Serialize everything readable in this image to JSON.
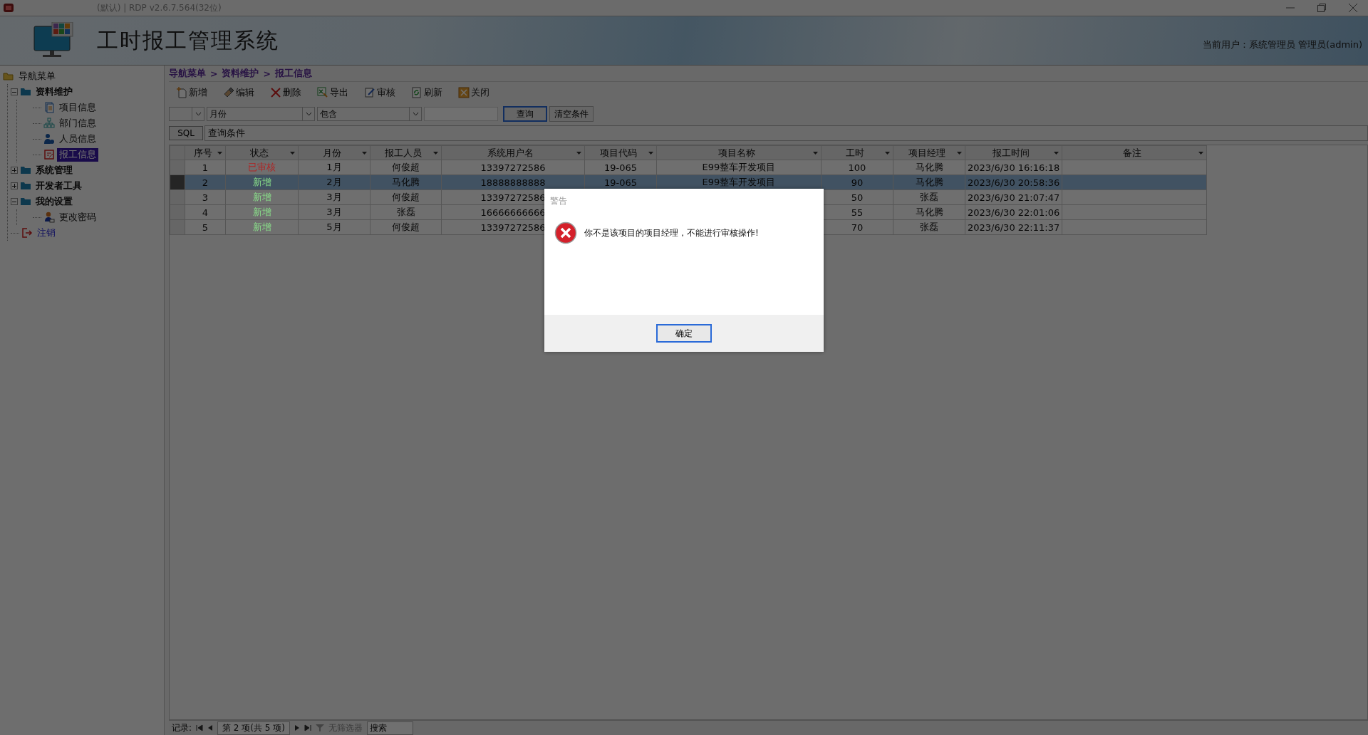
{
  "window": {
    "title": "(默认) | RDP v2.6.7.564(32位)"
  },
  "header": {
    "title": "工时报工管理系统",
    "user": "当前用户：系统管理员 管理员(admin)"
  },
  "sidebar": {
    "items": [
      {
        "label": "导航菜单",
        "kind": "root",
        "selected": false,
        "expanded": true,
        "children": [
          {
            "label": "资料维护",
            "kind": "folder",
            "selected": false,
            "expanded": true,
            "children": [
              {
                "label": "项目信息",
                "kind": "document",
                "selected": false
              },
              {
                "label": "部门信息",
                "kind": "org",
                "selected": false
              },
              {
                "label": "人员信息",
                "kind": "person",
                "selected": false
              },
              {
                "label": "报工信息",
                "kind": "report",
                "selected": true
              }
            ]
          },
          {
            "label": "系统管理",
            "kind": "folder",
            "selected": false,
            "expanded": false
          },
          {
            "label": "开发者工具",
            "kind": "folder",
            "selected": false,
            "expanded": false
          },
          {
            "label": "我的设置",
            "kind": "folder",
            "selected": false,
            "expanded": true,
            "children": [
              {
                "label": "更改密码",
                "kind": "user",
                "selected": false
              }
            ]
          },
          {
            "label": "注销",
            "kind": "logout",
            "selected": false
          }
        ]
      }
    ]
  },
  "breadcrumb": [
    "导航菜单",
    "资料维护",
    "报工信息"
  ],
  "breadcrumb_separator": ">",
  "toolbar": [
    {
      "label": "新增",
      "kind": "add"
    },
    {
      "label": "编辑",
      "kind": "edit"
    },
    {
      "label": "删除",
      "kind": "delete"
    },
    {
      "label": "导出",
      "kind": "export"
    },
    {
      "label": "审核",
      "kind": "audit"
    },
    {
      "label": "刷新",
      "kind": "refresh"
    },
    {
      "label": "关闭",
      "kind": "close"
    }
  ],
  "filter": {
    "field": "月份",
    "operator": "包含",
    "search_button": "查询",
    "clear_button": "清空条件",
    "sql_button": "SQL",
    "condition": "查询条件"
  },
  "table": {
    "columns": [
      "序号",
      "状态",
      "月份",
      "报工人员",
      "系统用户名",
      "项目代码",
      "项目名称",
      "工时",
      "项目经理",
      "报工时间",
      "备注"
    ],
    "rows": [
      {
        "selected": false,
        "color": "#b02424",
        "cells": [
          "1",
          "已审核",
          "1月",
          "何俊超",
          "13397272586",
          "19-065",
          "E99整车开发项目",
          "100",
          "马化腾",
          "2023/6/30 16:16:18",
          null
        ]
      },
      {
        "selected": true,
        "color": "#8ae08a",
        "cells": [
          "2",
          "新增",
          "2月",
          "马化腾",
          "18888888888",
          "19-065",
          "E99整车开发项目",
          "90",
          "马化腾",
          "2023/6/30 20:58:36",
          null
        ]
      },
      {
        "selected": false,
        "color": "#8ae08a",
        "cells": [
          "3",
          "新增",
          "3月",
          "何俊超",
          "13397272586",
          null,
          null,
          "50",
          "张磊",
          "2023/6/30 21:07:47",
          null
        ]
      },
      {
        "selected": false,
        "color": "#8ae08a",
        "cells": [
          "4",
          "新增",
          "3月",
          "张磊",
          "16666666666",
          null,
          null,
          "55",
          "马化腾",
          "2023/6/30 22:01:06",
          null
        ]
      },
      {
        "selected": false,
        "color": "#8ae08a",
        "cells": [
          "5",
          "新增",
          "5月",
          "何俊超",
          "13397272586",
          null,
          null,
          "70",
          "张磊",
          "2023/6/30 22:11:37",
          null
        ]
      }
    ]
  },
  "status_bar": {
    "record_label": "记录:",
    "position": "第 2 项(共 5 项)",
    "filter": "无筛选器",
    "search": "搜索"
  },
  "dialog": {
    "title": "警告",
    "message": "你不是该项目的项目经理，不能进行审核操作!",
    "button": "确定"
  }
}
